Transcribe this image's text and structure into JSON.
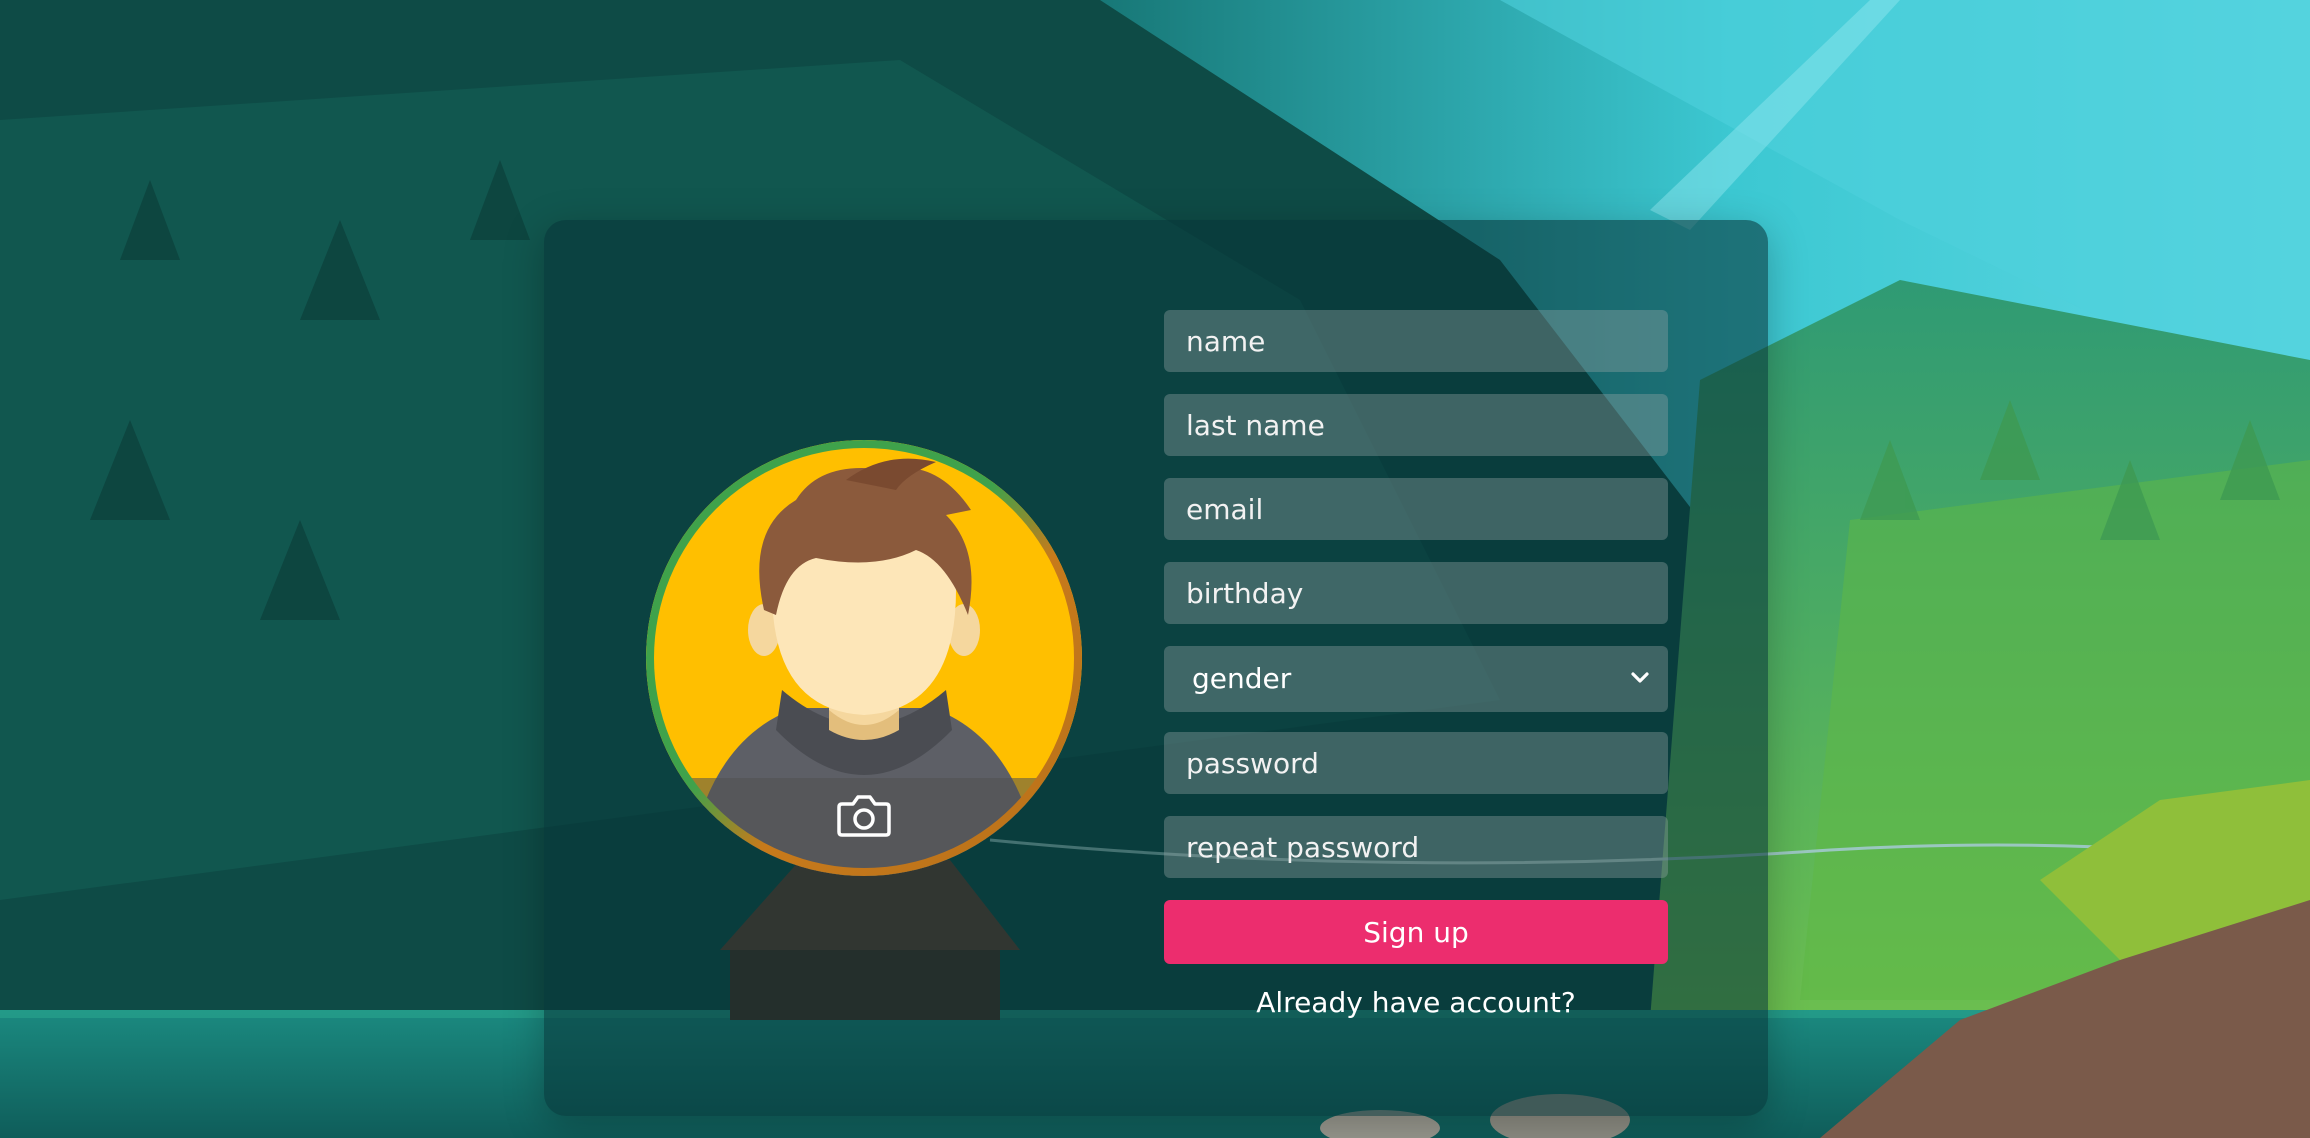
{
  "form": {
    "name_placeholder": "name",
    "last_name_placeholder": "last name",
    "email_placeholder": "email",
    "birthday_placeholder": "birthday",
    "gender_selected": "gender",
    "password_placeholder": "password",
    "repeat_password_placeholder": "repeat password",
    "signup_label": "Sign up",
    "login_link": "Already have account?"
  },
  "avatar": {
    "icon": "camera-icon",
    "image": "default-user-avatar"
  },
  "colors": {
    "accent": "#ec2d6e",
    "avatar_bg": "#ffbf00",
    "card_bg": "#073437"
  }
}
